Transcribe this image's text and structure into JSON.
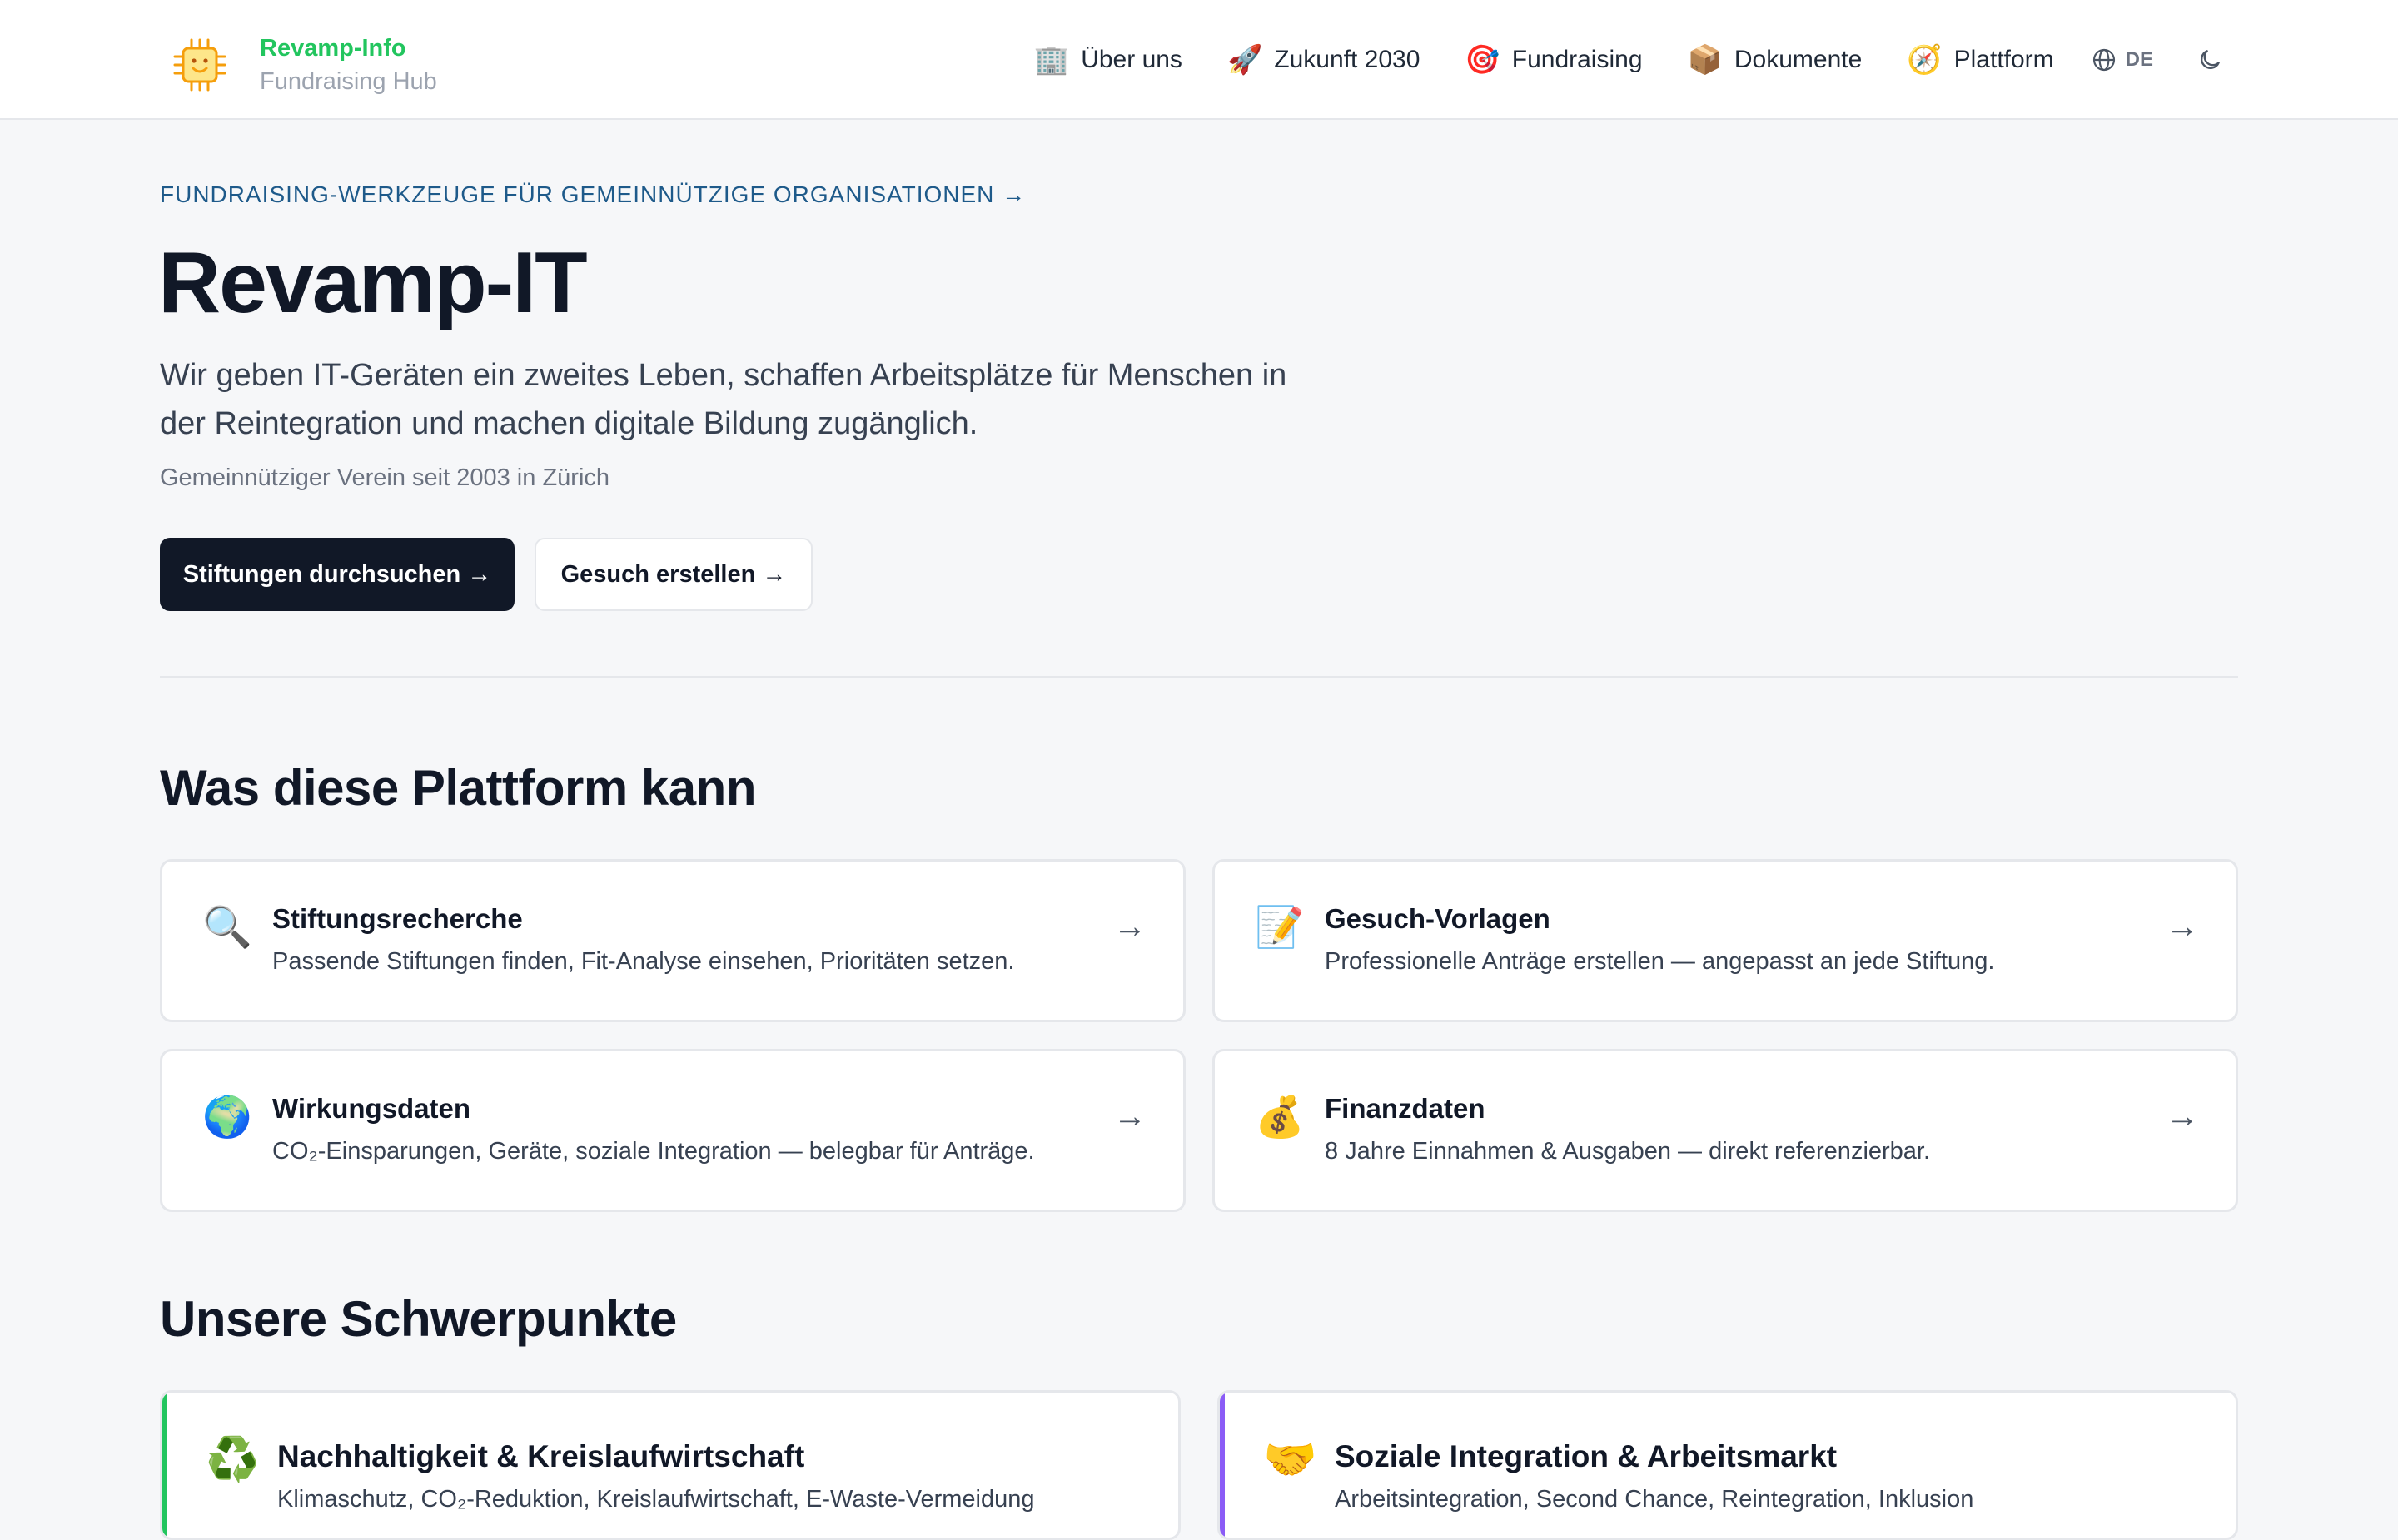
{
  "header": {
    "brand_title": "Revamp-Info",
    "brand_subtitle": "Fundraising Hub",
    "nav": [
      {
        "emoji": "🏢",
        "label": "Über uns"
      },
      {
        "emoji": "🚀",
        "label": "Zukunft 2030"
      },
      {
        "emoji": "🎯",
        "label": "Fundraising"
      },
      {
        "emoji": "📦",
        "label": "Dokumente"
      },
      {
        "emoji": "🧭",
        "label": "Plattform"
      }
    ],
    "language": "DE"
  },
  "hero": {
    "eyebrow": "FUNDRAISING-WERKZEUGE FÜR GEMEINNÜTZIGE ORGANISATIONEN →",
    "title": "Revamp-IT",
    "description": "Wir geben IT-Geräten ein zweites Leben, schaffen Arbeitsplätze für Menschen in der Reintegration und machen digitale Bildung zugänglich.",
    "note": "Gemeinnütziger Verein seit 2003 in Zürich",
    "primary_button": "Stiftungen durchsuchen →",
    "secondary_button": "Gesuch erstellen →"
  },
  "features": {
    "title": "Was diese Plattform kann",
    "cards": [
      {
        "icon": "🔍",
        "title": "Stiftungsrecherche",
        "description": "Passende Stiftungen finden, Fit-Analyse einsehen, Prioritäten setzen.",
        "arrow": "→"
      },
      {
        "icon": "📝",
        "title": "Gesuch-Vorlagen",
        "description": "Professionelle Anträge erstellen — angepasst an jede Stiftung.",
        "arrow": "→"
      },
      {
        "icon": "🌍",
        "title": "Wirkungsdaten",
        "description": "CO₂-Einsparungen, Geräte, soziale Integration — belegbar für Anträge.",
        "arrow": "→"
      },
      {
        "icon": "💰",
        "title": "Finanzdaten",
        "description": "8 Jahre Einnahmen & Ausgaben — direkt referenzierbar.",
        "arrow": "→"
      }
    ]
  },
  "focus": {
    "title": "Unsere Schwerpunkte",
    "cards": [
      {
        "icon": "♻️",
        "title": "Nachhaltigkeit & Kreislaufwirtschaft",
        "description": "Klimaschutz, CO₂-Reduktion, Kreislaufwirtschaft, E-Waste-Vermeidung",
        "accent": "#22c55e"
      },
      {
        "icon": "🤝",
        "title": "Soziale Integration & Arbeitsmarkt",
        "description": "Arbeitsintegration, Second Chance, Reintegration, Inklusion",
        "accent": "#8b5cf6"
      }
    ]
  },
  "colors": {
    "brand": "#22c55e",
    "eyebrow": "#1e5a8a",
    "primary_button": "#111827"
  }
}
